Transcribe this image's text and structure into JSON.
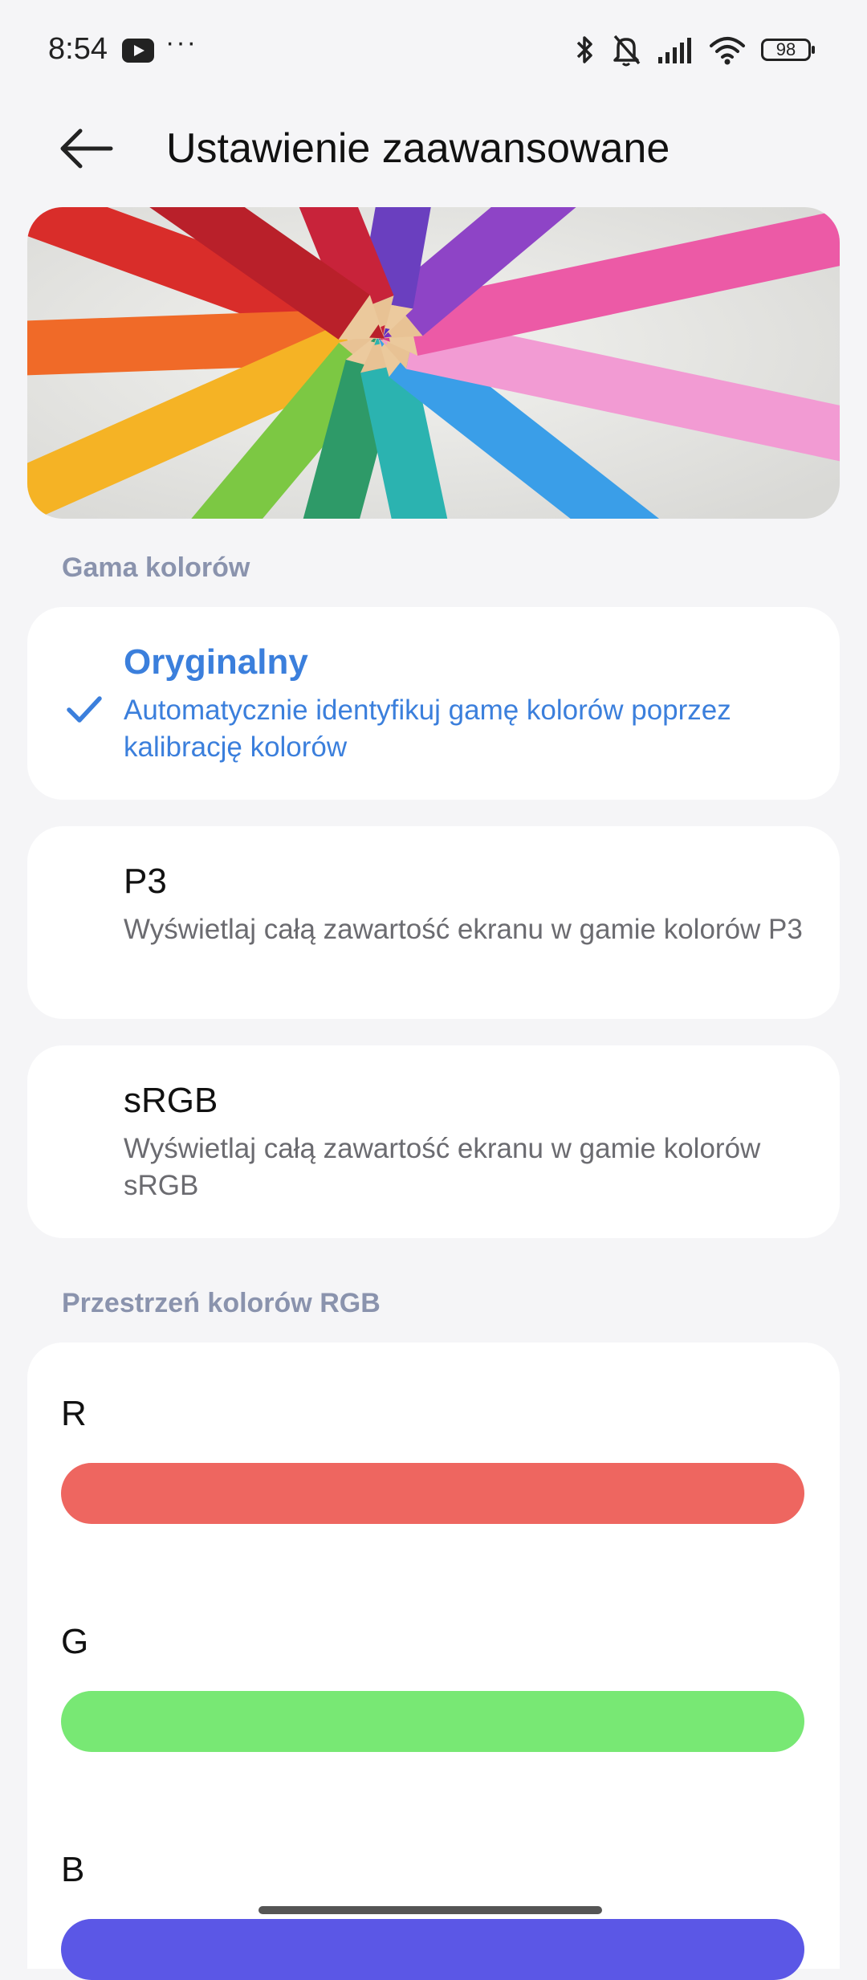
{
  "status_bar": {
    "time": "8:54",
    "battery": "98",
    "icons": [
      "youtube-icon",
      "more-dots-icon",
      "bluetooth-icon",
      "bell-muted-icon",
      "cellular-signal-icon",
      "wifi-icon",
      "battery-icon"
    ]
  },
  "header": {
    "title": "Ustawienie zaawansowane",
    "back_icon": "arrow-left-icon"
  },
  "color_gamut": {
    "section_title": "Gama kolorów",
    "options": [
      {
        "title": "Oryginalny",
        "description": "Automatycznie identyfikuj gamę kolorów poprzez kalibrację kolorów",
        "selected": true
      },
      {
        "title": "P3",
        "description": "Wyświetlaj całą zawartość ekranu w gamie kolorów P3",
        "selected": false
      },
      {
        "title": "sRGB",
        "description": "Wyświetlaj całą zawartość ekranu w gamie kolorów sRGB",
        "selected": false
      }
    ]
  },
  "rgb_space": {
    "section_title": "Przestrzeń kolorów RGB",
    "channels": [
      {
        "label": "R",
        "color": "#ee6660",
        "level": 1.0
      },
      {
        "label": "G",
        "color": "#78e874",
        "level": 1.0
      },
      {
        "label": "B",
        "color": "#5b57e6",
        "level": 1.0
      }
    ]
  },
  "colors": {
    "accent": "#3b7fdc",
    "section_title": "#8a93ad",
    "background": "#f5f5f7"
  }
}
